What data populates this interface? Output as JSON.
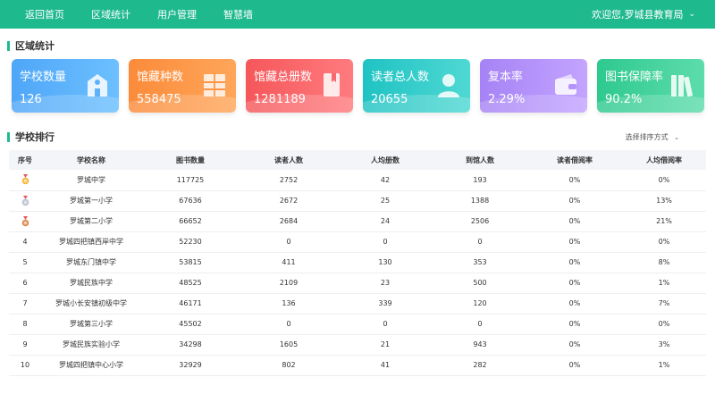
{
  "nav": {
    "items": [
      "返回首页",
      "区域统计",
      "用户管理",
      "智慧墙"
    ],
    "user_label": "欢迎您,罗城县教育局"
  },
  "region_section": {
    "title": "区域统计"
  },
  "stats": [
    {
      "label": "学校数量",
      "value": "126",
      "icon": "school-building-icon",
      "color_from": "#4fa6f7",
      "color_to": "#6cc0ff"
    },
    {
      "label": "馆藏种数",
      "value": "558475",
      "icon": "bookshelf-icon",
      "color_from": "#fb8b3a",
      "color_to": "#ffa65a"
    },
    {
      "label": "馆藏总册数",
      "value": "1281189",
      "icon": "book-icon",
      "color_from": "#f5575b",
      "color_to": "#ff7b7e"
    },
    {
      "label": "读者总人数",
      "value": "20655",
      "icon": "person-icon",
      "color_from": "#1fc3c3",
      "color_to": "#4fd8d3"
    },
    {
      "label": "复本率",
      "value": "2.29%",
      "icon": "wallet-icon",
      "color_from": "#a683f5",
      "color_to": "#c3a4ff"
    },
    {
      "label": "图书保障率",
      "value": "90.2%",
      "icon": "books-icon",
      "color_from": "#2ec98f",
      "color_to": "#5ddcac"
    }
  ],
  "ranking_section": {
    "title": "学校排行",
    "sort_label": "选择排序方式"
  },
  "table": {
    "headers": [
      "序号",
      "学校名称",
      "图书数量",
      "读者人数",
      "人均册数",
      "到馆人数",
      "读者借阅率",
      "人均借阅率"
    ],
    "rows": [
      {
        "rank": "",
        "medal": "gold-medal-icon",
        "name": "罗城中学",
        "books": "117725",
        "readers": "2752",
        "per_capita": "42",
        "visits": "193",
        "reader_rate": "0%",
        "borrow_rate": "0%"
      },
      {
        "rank": "",
        "medal": "silver-medal-icon",
        "name": "罗城第一小学",
        "books": "67636",
        "readers": "2672",
        "per_capita": "25",
        "visits": "1388",
        "reader_rate": "0%",
        "borrow_rate": "13%"
      },
      {
        "rank": "",
        "medal": "bronze-medal-icon",
        "name": "罗城第二小学",
        "books": "66652",
        "readers": "2684",
        "per_capita": "24",
        "visits": "2506",
        "reader_rate": "0%",
        "borrow_rate": "21%"
      },
      {
        "rank": "4",
        "medal": "",
        "name": "罗城四把镇西岸中学",
        "books": "52230",
        "readers": "0",
        "per_capita": "0",
        "visits": "0",
        "reader_rate": "0%",
        "borrow_rate": "0%"
      },
      {
        "rank": "5",
        "medal": "",
        "name": "罗城东门镇中学",
        "books": "53815",
        "readers": "411",
        "per_capita": "130",
        "visits": "353",
        "reader_rate": "0%",
        "borrow_rate": "8%"
      },
      {
        "rank": "6",
        "medal": "",
        "name": "罗城民族中学",
        "books": "48525",
        "readers": "2109",
        "per_capita": "23",
        "visits": "500",
        "reader_rate": "0%",
        "borrow_rate": "1%"
      },
      {
        "rank": "7",
        "medal": "",
        "name": "罗城小长安镇初级中学",
        "books": "46171",
        "readers": "136",
        "per_capita": "339",
        "visits": "120",
        "reader_rate": "0%",
        "borrow_rate": "7%"
      },
      {
        "rank": "8",
        "medal": "",
        "name": "罗城第三小学",
        "books": "45502",
        "readers": "0",
        "per_capita": "0",
        "visits": "0",
        "reader_rate": "0%",
        "borrow_rate": "0%"
      },
      {
        "rank": "9",
        "medal": "",
        "name": "罗城民族实验小学",
        "books": "34298",
        "readers": "1605",
        "per_capita": "21",
        "visits": "943",
        "reader_rate": "0%",
        "borrow_rate": "3%"
      },
      {
        "rank": "10",
        "medal": "",
        "name": "罗城四把镇中心小学",
        "books": "32929",
        "readers": "802",
        "per_capita": "41",
        "visits": "282",
        "reader_rate": "0%",
        "borrow_rate": "1%"
      }
    ]
  }
}
